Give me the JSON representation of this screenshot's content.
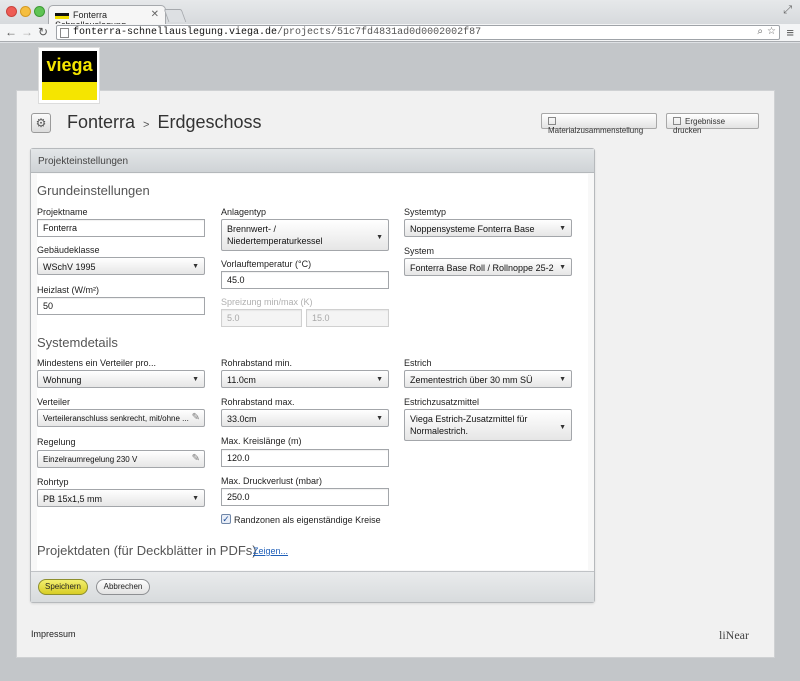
{
  "browser": {
    "tab_title": "Fonterra Schnellauslegung",
    "url_host": "fonterra-schnellauslegung.viega.de",
    "url_path": "/projects/51c7fd4831ad0d0002002f87"
  },
  "logo": {
    "text": "viega"
  },
  "header": {
    "breadcrumb_project": "Fonterra",
    "breadcrumb_separator": ">",
    "breadcrumb_floor": "Erdgeschoss",
    "btn_materials": "Materialzusammenstellung",
    "btn_print": "Ergebnisse drucken"
  },
  "panel": {
    "title": "Projekteinstellungen",
    "section_basic": "Grundeinstellungen",
    "section_system": "Systemdetails",
    "section_project": "Projektdaten (für Deckblätter in PDFs)",
    "show_link": "Zeigen..."
  },
  "basic": {
    "projektname_label": "Projektname",
    "projektname_value": "Fonterra",
    "gebaeude_label": "Gebäudeklasse",
    "gebaeude_value": "WSchV 1995",
    "heizlast_label": "Heizlast (W/m²)",
    "heizlast_value": "50",
    "anlagentyp_label": "Anlagentyp",
    "anlagentyp_value": "Brennwert- / Niedertemperaturkessel",
    "vorlauf_label": "Vorlauftemperatur (°C)",
    "vorlauf_value": "45.0",
    "spreizung_label": "Spreizung min/max (K)",
    "spreizung_min": "5.0",
    "spreizung_max": "15.0",
    "systemtyp_label": "Systemtyp",
    "systemtyp_value": "Noppensysteme Fonterra Base",
    "system_label": "System",
    "system_value": "Fonterra Base Roll / Rollnoppe 25-2"
  },
  "system": {
    "verteiler_pro_label": "Mindestens ein Verteiler pro...",
    "verteiler_pro_value": "Wohnung",
    "verteiler_label": "Verteiler",
    "verteiler_value": "Verteileranschluss senkrecht, mit/ohne ...",
    "regelung_label": "Regelung",
    "regelung_value": "Einzelraumregelung 230 V",
    "rohrtyp_label": "Rohrtyp",
    "rohrtyp_value": "PB 15x1,5 mm",
    "rohrabstand_min_label": "Rohrabstand min.",
    "rohrabstand_min_value": "11.0cm",
    "rohrabstand_max_label": "Rohrabstand max.",
    "rohrabstand_max_value": "33.0cm",
    "kreislaenge_label": "Max. Kreislänge (m)",
    "kreislaenge_value": "120.0",
    "druckverlust_label": "Max. Druckverlust (mbar)",
    "druckverlust_value": "250.0",
    "randzonen_label": "Randzonen als eigenständige Kreise",
    "estrich_label": "Estrich",
    "estrich_value": "Zementestrich über 30 mm SÜ",
    "zusatz_label": "Estrichzusatzmittel",
    "zusatz_value": "Viega Estrich-Zusatzmittel für Normalestrich."
  },
  "actions": {
    "save": "Speichern",
    "cancel": "Abbrechen"
  },
  "footer": {
    "impressum": "Impressum",
    "brand": "liNear"
  }
}
